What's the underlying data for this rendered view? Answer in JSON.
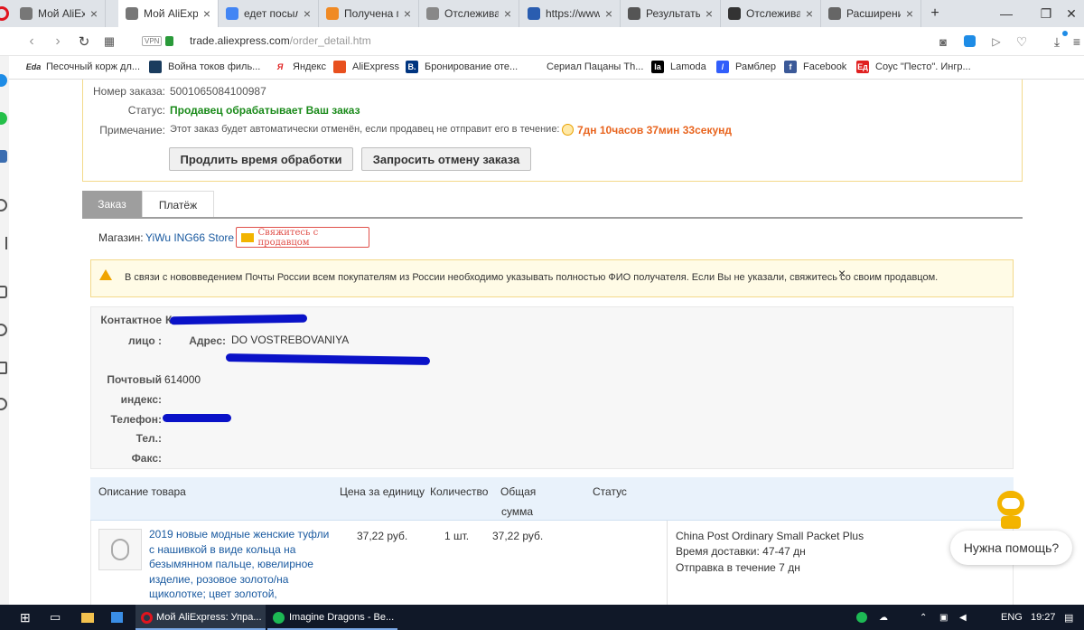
{
  "browser": {
    "tabs": [
      {
        "title": "Мой AliExpre",
        "fav": "aliexpress-icon",
        "color": "#777"
      },
      {
        "title": "Мой AliExpre",
        "fav": "aliexpress-icon",
        "color": "#777"
      },
      {
        "title": "едет посылк",
        "fav": "google-icon",
        "color": "#4285f4"
      },
      {
        "title": "Получена по",
        "fav": "notification-icon",
        "color": "#f08a24"
      },
      {
        "title": "Отслеживан",
        "fav": "tracking-icon",
        "color": "#888"
      },
      {
        "title": "https://www.",
        "fav": "russian-post-icon",
        "color": "#2a5db0"
      },
      {
        "title": "Результаты",
        "fav": "results-icon",
        "color": "#555"
      },
      {
        "title": "Отслеживан",
        "fav": "tracking-icon",
        "color": "#333"
      },
      {
        "title": "Расширения",
        "fav": "extensions-icon",
        "color": "#666"
      }
    ],
    "new_tab": "+",
    "url_domain": "trade.aliexpress.com",
    "url_path": "/order_detail.htm",
    "vpn": "VPN",
    "bookmarks": [
      {
        "label": "Песочный корж дл...",
        "icon": "eda-icon",
        "badge": "Eda",
        "color": "#fff"
      },
      {
        "label": "Война токов филь...",
        "icon": "film-icon",
        "badge": "",
        "color": "#1a3c5e"
      },
      {
        "label": "Яндекс",
        "icon": "yandex-icon",
        "badge": "Я",
        "color": "#fff"
      },
      {
        "label": "AliExpress",
        "icon": "aliexpress-icon",
        "badge": "",
        "color": "#e8501e"
      },
      {
        "label": "Бронирование оте...",
        "icon": "booking-icon",
        "badge": "B.",
        "color": "#003580"
      },
      {
        "label": "Сериал Пацаны Th...",
        "icon": "series-icon",
        "badge": "",
        "color": "#fff"
      },
      {
        "label": "Lamoda",
        "icon": "lamoda-icon",
        "badge": "la",
        "color": "#000"
      },
      {
        "label": "Рамблер",
        "icon": "rambler-icon",
        "badge": "/",
        "color": "#315efb"
      },
      {
        "label": "Facebook",
        "icon": "facebook-icon",
        "badge": "f",
        "color": "#3b5998"
      },
      {
        "label": "Соус \"Песто\". Ингр...",
        "icon": "recipe-icon",
        "badge": "Ед",
        "color": "#e02020"
      }
    ]
  },
  "order": {
    "number_label": "Номер заказа:",
    "number": "5001065084100987",
    "status_label": "Статус:",
    "status": "Продавец обрабатывает Ваш заказ",
    "note_label": "Примечание:",
    "note": "Этот заказ будет автоматически отменён, если продавец не отправит его в течение:",
    "timer": "7дн 10часов 37мин 33секунд",
    "timer_dot": ".",
    "extend_button": "Продлить время обработки",
    "cancel_button": "Запросить отмену заказа"
  },
  "tabs": {
    "order": "Заказ",
    "payment": "Платёж"
  },
  "store": {
    "label": "Магазин:",
    "name": "YiWu ING66 Store",
    "contact": "Свяжитесь с продавцом"
  },
  "notice": {
    "text": "В связи с нововведением Почты России всем покупателям из России необходимо указывать полностью ФИО получателя. Если Вы не указали, свяжитесь со своим продавцом.",
    "close": "×"
  },
  "contact": {
    "person_label_1": "Контактное",
    "person_label_2": "лицо :",
    "person_partial": "К",
    "address_label": "Адрес:",
    "address": "DO VOSTREBOVANIYA",
    "zip_label_1": "Почтовый",
    "zip_label_2": "индекс:",
    "zip": "614000",
    "phone_label": "Телефон:",
    "tel_label": "Тел.:",
    "fax_label": "Факс:"
  },
  "table": {
    "headers": [
      "Описание товара",
      "Цена за единицу",
      "Количество",
      "Общая",
      "сумма",
      "Статус"
    ],
    "item": {
      "title_lines": [
        "2019 новые модные женские туфли",
        "с нашивкой в виде кольца на",
        "безымянном пальце, ювелирное",
        "изделие, розовое золото/на",
        "щиколотке; цвет золотой,"
      ],
      "price": "37,22 руб.",
      "qty": "1 шт.",
      "total": "37,22 руб.",
      "shipping": "China Post Ordinary Small Packet Plus",
      "delivery": "Время доставки: 47-47 дн",
      "dispatch": "Отправка в течение 7 дн"
    }
  },
  "help": {
    "text": "Нужна помощь?"
  },
  "taskbar": {
    "app1": "Мой AliExpress: Упра...",
    "app2": "Imagine Dragons - Be...",
    "lang": "ENG",
    "time": "19:27"
  }
}
